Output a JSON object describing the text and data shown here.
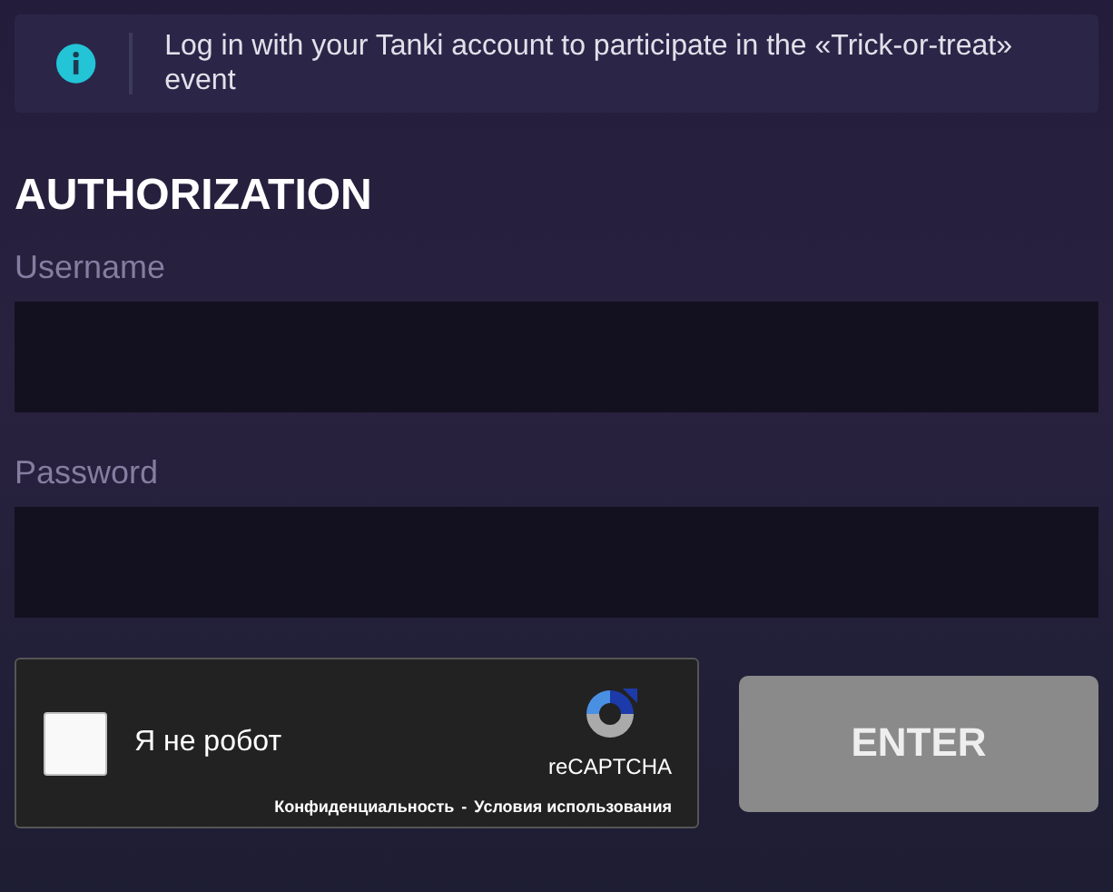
{
  "notice": {
    "text": "Log in with your Tanki account to participate in the «Trick-or-treat» event"
  },
  "title": "AUTHORIZATION",
  "fields": [
    {
      "label": "Username"
    },
    {
      "label": "Password"
    }
  ],
  "captcha": {
    "checked": false,
    "label": "Я не робот",
    "brand": "reCAPTCHA",
    "links": [
      "Конфиденциальность",
      "Условия использования"
    ],
    "separator": "-"
  },
  "enter_button": {
    "label": "ENTER",
    "disabled": true
  }
}
